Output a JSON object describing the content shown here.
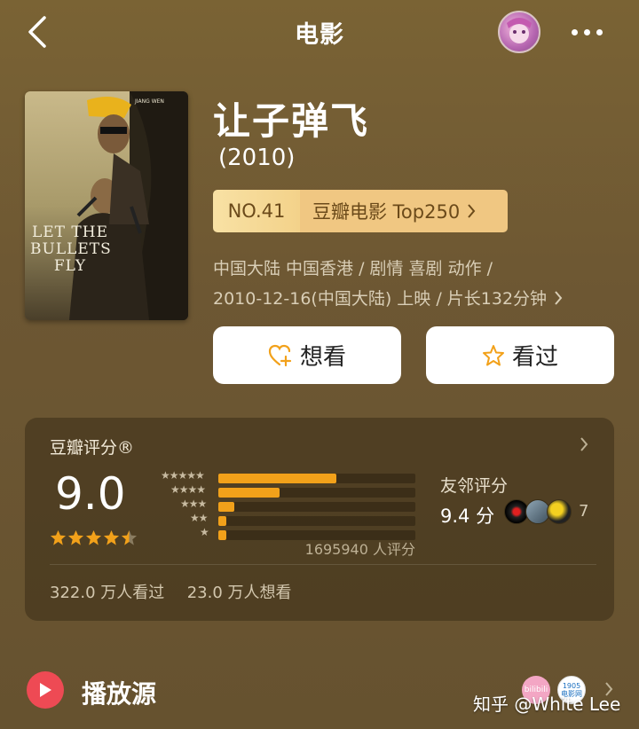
{
  "header": {
    "title": "电影"
  },
  "movie": {
    "title": "让子弹飞",
    "year": "(2010)",
    "rank_no": "NO.41",
    "rank_list": "豆瓣电影 Top250",
    "meta_line1": "中国大陆 中国香港 / 剧情 喜剧 动作 /",
    "meta_line2": "2010-12-16(中国大陆) 上映 / 片长132分钟",
    "poster_title": "LET THE BULLETS FLY",
    "poster_top": "JIANG WEN"
  },
  "actions": {
    "want": "想看",
    "watched": "看过"
  },
  "rating": {
    "label": "豆瓣评分®",
    "score": "9.0",
    "stars": 4.5,
    "distribution": [
      {
        "stars": "★★★★★",
        "percent": 0.6
      },
      {
        "stars": "★★★★",
        "percent": 0.31
      },
      {
        "stars": "★★★",
        "percent": 0.08
      },
      {
        "stars": "★★",
        "percent": 0.04
      },
      {
        "stars": "★",
        "percent": 0.04
      }
    ],
    "count": "1695940 人评分",
    "friends_label": "友邻评分",
    "friends_score": "9.4 分",
    "friends_count": "7",
    "watched_count": "322.0 万人看过",
    "want_count": "23.0 万人想看"
  },
  "play_source": {
    "label": "播放源",
    "sources": [
      "bilibili",
      "1905 电影网"
    ]
  },
  "watermark": "知乎 @White Lee",
  "colors": {
    "accent": "#f2a11a",
    "play": "#ee4a54"
  }
}
